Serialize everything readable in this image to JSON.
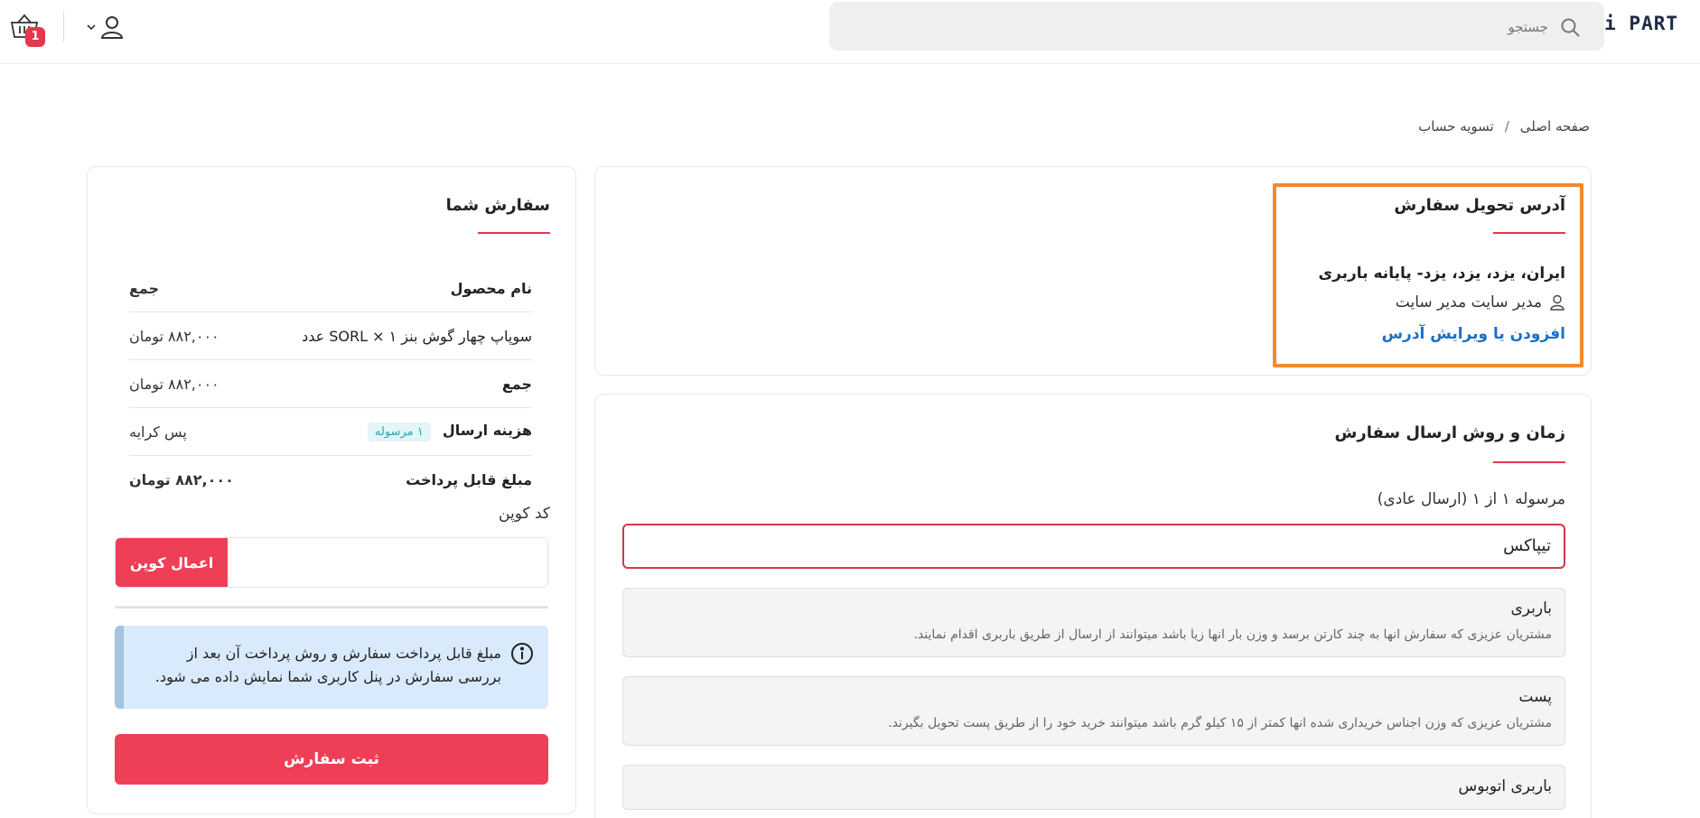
{
  "header": {
    "logo": "i PART",
    "search": {
      "placeholder": "جستجو",
      "value": ""
    },
    "cart_count": "1"
  },
  "breadcrumb": {
    "home": "صفحه اصلی",
    "separator": "/",
    "current": "تسویه حساب"
  },
  "address": {
    "title": "آدرس تحویل سفارش",
    "line": "ایران، یزد، یزد، یزد- پایانه باربری",
    "recipient": "مدیر سایت مدیر سایت",
    "edit_link": "افزودن یا ویرایش آدرس"
  },
  "shipping": {
    "title": "زمان و روش ارسال سفارش",
    "shipment_label": "مرسوله ۱ از ۱ (ارسال عادی)",
    "options": [
      {
        "title": "تیپاکس",
        "desc": ""
      },
      {
        "title": "باربری",
        "desc": "مشتریان عزیزی که سفارش انها به چند کارتن برسد و وزن بار انها زیا باشد میتوانند از ارسال از طریق باربری اقدام نمایند."
      },
      {
        "title": "پست",
        "desc": "مشتریان عزیزی که وزن اجناس خریداری شده انها کمتر از ۱۵ کیلو گرم باشد میتوانند خرید خود را از طریق پست تحویل بگیرند."
      },
      {
        "title": "باربری اتوبوس",
        "desc": ""
      }
    ]
  },
  "order": {
    "title": "سفارش شما",
    "headers": {
      "product": "نام محصول",
      "total": "جمع"
    },
    "item": {
      "name": "سوپاپ چهار گوش بنز SORL × ۱ عدد",
      "price": "۸۸۲,۰۰۰ تومان"
    },
    "subtotal": {
      "label": "جمع",
      "value": "۸۸۲,۰۰۰ تومان"
    },
    "shipping_cost": {
      "label": "هزینه ارسال",
      "badge": "۱ مرسوله",
      "value": "پس کرایه"
    },
    "payable": {
      "label": "مبلغ قابل پرداخت",
      "value": "۸۸۲,۰۰۰ تومان"
    },
    "coupon": {
      "label": "کد کوپن",
      "button": "اعمال کوپن",
      "placeholder": ""
    },
    "info": "مبلغ قابل پرداخت سفارش و روش پرداخت آن بعد از بررسی سفارش در پنل کاربری شما نمایش داده می شود.",
    "submit": "ثبت سفارش"
  },
  "colors": {
    "accent": "#ef3f56",
    "highlight": "#f28a2e",
    "link": "#1a6fc7",
    "info_bg": "#d8eafc"
  }
}
